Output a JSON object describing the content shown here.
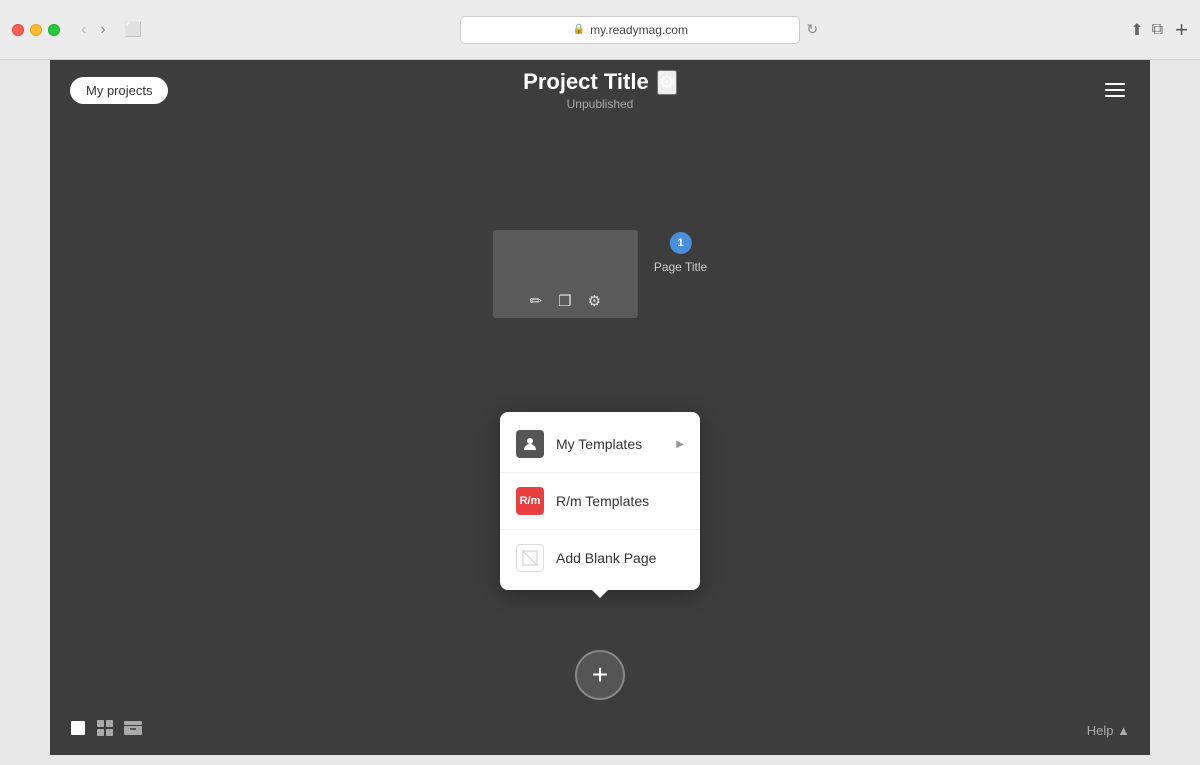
{
  "browser": {
    "url": "my.readymag.com",
    "back_btn": "‹",
    "forward_btn": "›",
    "reader_btn": "⬜",
    "reload_btn": "↻",
    "share_btn": "⬆",
    "duplicate_btn": "⧉",
    "new_tab_btn": "+"
  },
  "header": {
    "my_projects_label": "My projects",
    "project_title": "Project Title",
    "settings_icon": "⚙",
    "project_status": "Unpublished",
    "hamburger_label": "Menu"
  },
  "page_card": {
    "page_number": "1",
    "page_label": "Page Title",
    "edit_icon": "✏",
    "copy_icon": "❐",
    "settings_icon": "⚙"
  },
  "add_page": {
    "button_label": "+"
  },
  "popup_menu": {
    "items": [
      {
        "id": "my-templates",
        "icon_type": "person",
        "icon_text": "👤",
        "label": "My Templates",
        "has_arrow": true
      },
      {
        "id": "rm-templates",
        "icon_type": "rm",
        "icon_text": "R/m",
        "label": "R/m Templates",
        "has_arrow": false
      },
      {
        "id": "blank-page",
        "icon_type": "blank",
        "icon_text": "▨",
        "label": "Add Blank Page",
        "has_arrow": false
      }
    ]
  },
  "bottom_bar": {
    "single_view_icon": "▪",
    "grid_view_icon": "⊞",
    "archive_icon": "⬛",
    "help_label": "Help ▲"
  }
}
